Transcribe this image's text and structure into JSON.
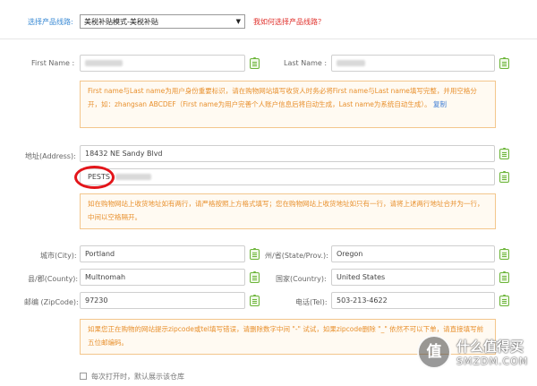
{
  "route": {
    "label": "选择产品线路:",
    "selected": "美税补贴模式-美税补贴",
    "help_link": "我如何选择产品线路？"
  },
  "name": {
    "first_label": "First Name :",
    "last_label": "Last Name :",
    "notice_text": "First name与Last name为用户身份重要标识，请在购物网站填写收货人时务必将First name与Last name填写完整，并用空格分开，如：zhangsan ABCDEF（First name为用户完善个人账户信息后将自动生成，Last name为系统自动生成）。",
    "copy_link": "复制"
  },
  "address": {
    "label": "地址(Address):",
    "line1": "18432 NE Sandy Blvd",
    "line2": "PESTS",
    "notice_text": "如在购物网站上收货地址如有两行，请严格按照上方格式填写；您在购物网站上收货地址如只有一行，请将上述两行地址合并为一行，中间以空格隔开。"
  },
  "location": {
    "city_label": "城市(City):",
    "city": "Portland",
    "state_label": "州/省(State/Prov.):",
    "state": "Oregon",
    "county_label": "县/郡(County):",
    "county": "Multnomah",
    "country_label": "国家(Country):",
    "country": "United States",
    "zip_label": "邮编 (ZipCode):",
    "zip": "97230",
    "tel_label": "电话(Tel):",
    "tel": "503-213-4622",
    "notice_text": "如果您正在购物的网站提示zipcode或tel填写错误，请删除数字中间 \"-\" 试试，如果zipcode删除 \"_\" 依然不可以下单，请直接填写前五位邮编码。"
  },
  "footer": {
    "checkbox_label": "每次打开时，默认展示该仓库"
  },
  "watermark": {
    "glyph": "值",
    "cn": "什么值得买",
    "site": "SMZDM.COM"
  }
}
